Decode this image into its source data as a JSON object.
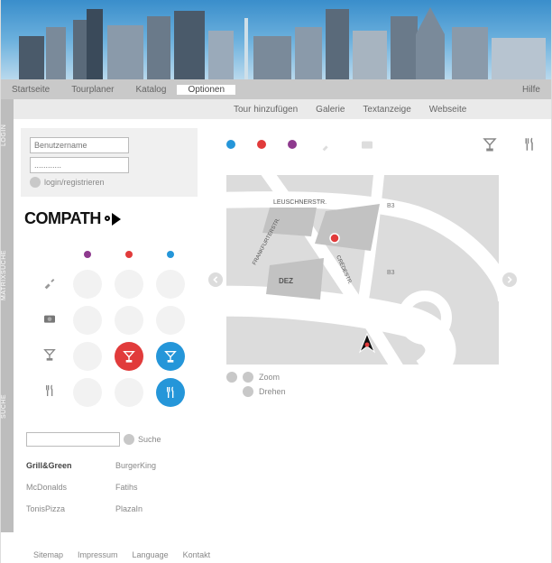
{
  "nav": {
    "items": [
      "Startseite",
      "Tourplaner",
      "Katalog",
      "Optionen"
    ],
    "active": 3,
    "help": "Hilfe"
  },
  "subnav": {
    "items": [
      "Tour hinzufügen",
      "Galerie",
      "Textanzeige",
      "Webseite"
    ]
  },
  "sideLabels": {
    "login": "LOGIN",
    "matrix": "MATRIXSUCHE",
    "suche": "SUCHE"
  },
  "login": {
    "userPlaceholder": "Benutzername",
    "passPlaceholder": "............",
    "action": "login/registrieren"
  },
  "logo": {
    "text": "COMPATH"
  },
  "matrixColors": {
    "c1": "#8e3a8e",
    "c2": "#e13b3b",
    "c3": "#2596d9"
  },
  "search": {
    "label": "Suche",
    "placeholder": ""
  },
  "results": [
    [
      "Grill&Green",
      "BurgerKing"
    ],
    [
      "McDonalds",
      "Fatihs"
    ],
    [
      "TonisPizza",
      "PlazaIn"
    ]
  ],
  "categoryDots": [
    "#2596d9",
    "#e13b3b",
    "#8e3a8e"
  ],
  "map": {
    "street1": "LEUSCHNERSTR.",
    "street2": "FRANKFURTERSTR.",
    "street3": "CRÉDESTR.",
    "label1": "DEZ",
    "road": "B3"
  },
  "controls": {
    "zoom": "Zoom",
    "rotate": "Drehen"
  },
  "footer": [
    "Sitemap",
    "Impressum",
    "Language",
    "Kontakt"
  ]
}
